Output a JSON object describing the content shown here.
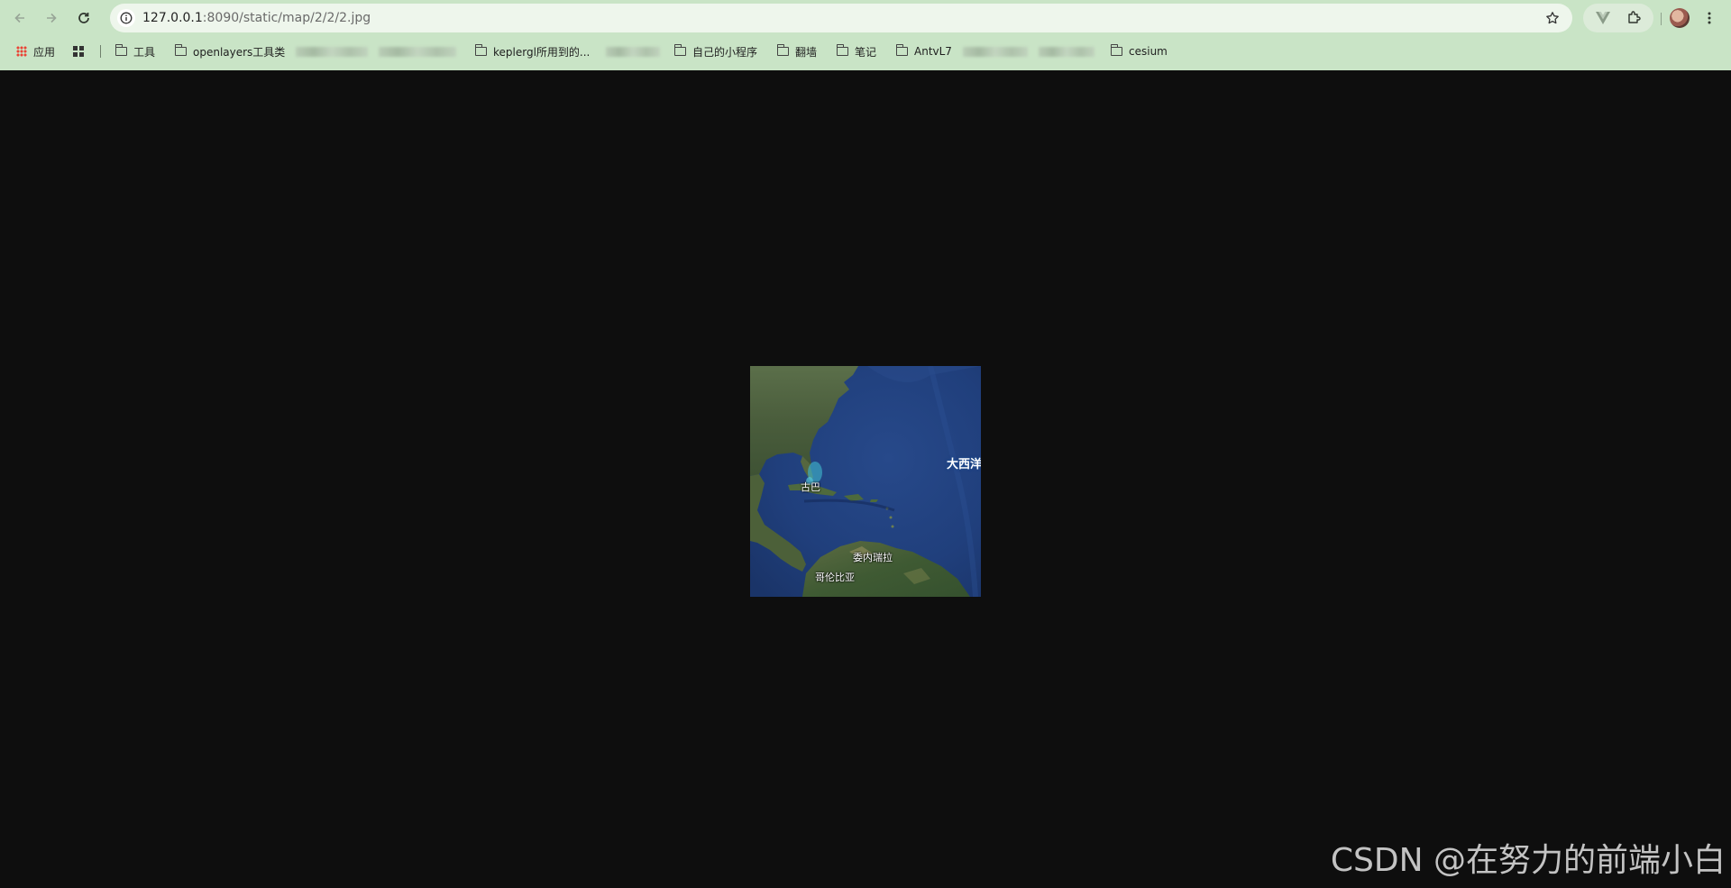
{
  "browser": {
    "url_host": "127.0.0.1",
    "url_rest": ":8090/static/map/2/2/2.jpg",
    "bookmarks": [
      {
        "type": "apps",
        "label": "应用"
      },
      {
        "type": "grid",
        "label": ""
      },
      {
        "type": "folder",
        "label": "工具"
      },
      {
        "type": "folder",
        "label": "openlayers工具类"
      },
      {
        "type": "folder",
        "label": "keplergl所用到的..."
      },
      {
        "type": "folder",
        "label": "自己的小程序"
      },
      {
        "type": "folder",
        "label": "翻墙"
      },
      {
        "type": "folder",
        "label": "笔记"
      },
      {
        "type": "folder",
        "label": "AntvL7"
      },
      {
        "type": "folder",
        "label": "cesium"
      }
    ]
  },
  "map": {
    "labels": {
      "cuba": "古巴",
      "atlantic": "大西洋",
      "venezuela": "委内瑞拉",
      "colombia": "哥伦比亚"
    }
  },
  "watermark": "CSDN @在努力的前端小白",
  "colors": {
    "chrome_bg": "#c9e4c6",
    "page_bg": "#0e0e0e",
    "ocean": "#1f3f7a"
  }
}
